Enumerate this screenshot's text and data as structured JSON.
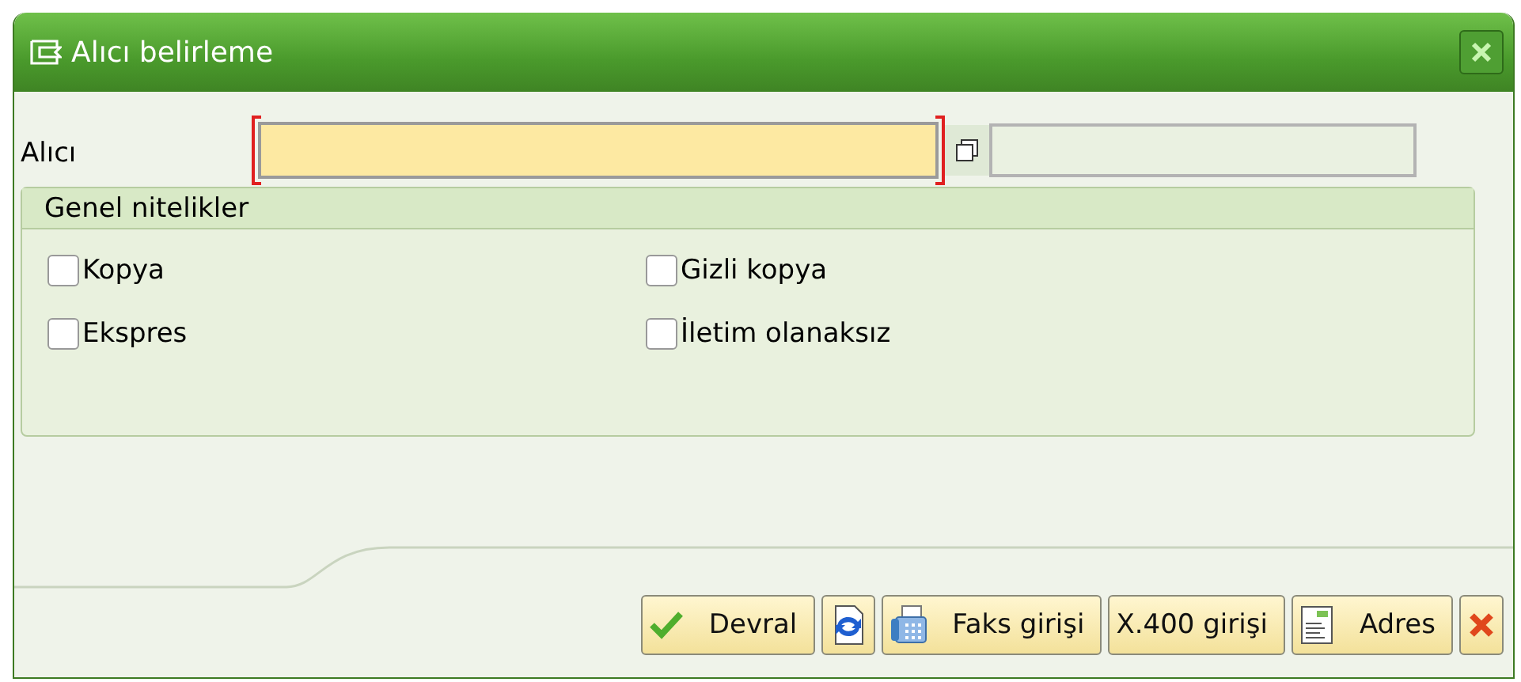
{
  "window": {
    "title": "Alıcı belirleme"
  },
  "recipient": {
    "label": "Alıcı",
    "required": true
  },
  "group": {
    "title": "Genel nitelikler",
    "checkboxes": [
      {
        "label": "Kopya",
        "checked": false
      },
      {
        "label": "Gizli kopya",
        "checked": false
      },
      {
        "label": "Ekspres",
        "checked": false
      },
      {
        "label": "İletim olanaksız",
        "checked": false
      }
    ]
  },
  "buttons": [
    {
      "kind": "accept",
      "label": "Devral"
    },
    {
      "kind": "refresh"
    },
    {
      "kind": "fax",
      "label": "Faks girişi"
    },
    {
      "kind": "plain",
      "label": "X.400 girişi"
    },
    {
      "kind": "address",
      "label": "Adres"
    },
    {
      "kind": "cancel"
    }
  ]
}
